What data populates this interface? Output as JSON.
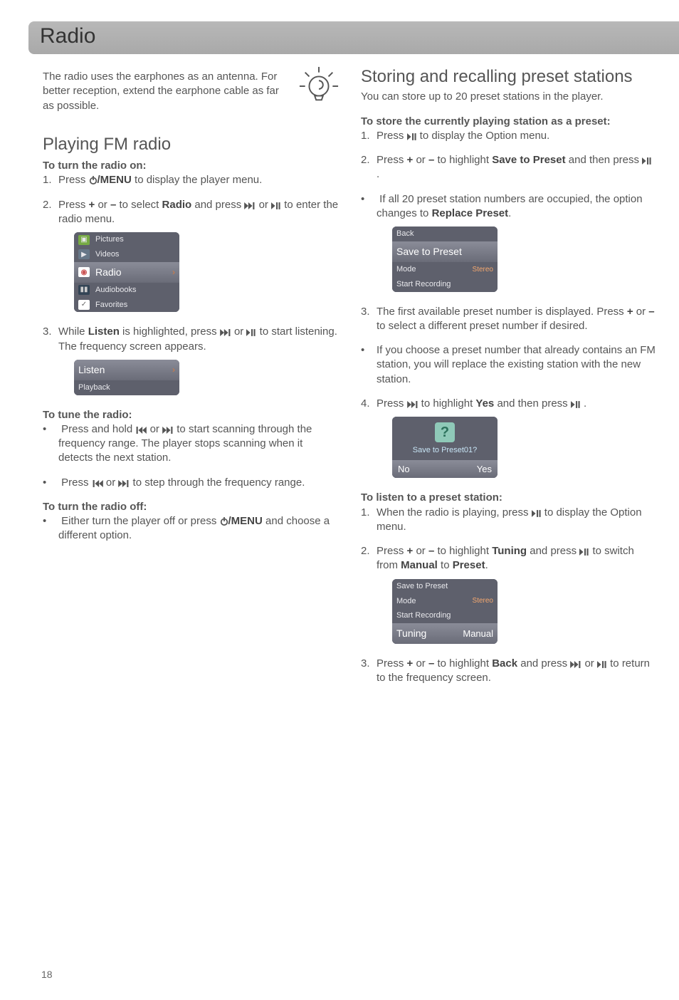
{
  "page_title": "Radio",
  "page_number": "18",
  "note": "The radio uses the earphones as an antenna. For better reception, extend the earphone cable as far as possible.",
  "left": {
    "h2": "Playing FM radio",
    "turn_on_head": "To turn the radio on:",
    "step1_a": "Press ",
    "step1_b": "/MENU",
    "step1_c": " to display the player menu.",
    "step2_a": "Press ",
    "step2_plus": "+",
    "step2_or": " or ",
    "step2_minus": "–",
    "step2_b": " to select ",
    "step2_radio": "Radio",
    "step2_c": " and press ",
    "step2_d": " or ",
    "step2_e": " to enter the radio menu.",
    "menu": {
      "pictures": "Pictures",
      "videos": "Videos",
      "radio": "Radio",
      "audiobooks": "Audiobooks",
      "favorites": "Favorites"
    },
    "step3_a": "While ",
    "step3_listen": "Listen",
    "step3_b": " is highlighted, press ",
    "step3_c": " or ",
    "step3_d": " to start listening. The frequency screen appears.",
    "listen_menu": {
      "listen": "Listen",
      "playback": "Playback"
    },
    "tune_head": "To tune the radio:",
    "tune1_a": "Press and hold ",
    "tune1_b": " or ",
    "tune1_c": " to start scanning through the frequency range. The player stops scanning when it detects the next station.",
    "tune2_a": "Press ",
    "tune2_b": " or ",
    "tune2_c": " to step through the frequency range.",
    "off_head": "To turn the radio off:",
    "off1_a": "Either turn the player off or press ",
    "off1_b": "/MENU",
    "off1_c": " and choose a different option."
  },
  "right": {
    "h2": "Storing and recalling preset stations",
    "intro": "You can store up to 20 preset stations in the player.",
    "store_head": "To store the currently playing station as a preset:",
    "s1_a": "Press ",
    "s1_b": " to display the Option menu.",
    "s2_a": "Press ",
    "s2_plus": "+",
    "s2_or": " or ",
    "s2_minus": "–",
    "s2_b": " to highlight ",
    "s2_save": "Save to Preset",
    "s2_c": " and then press ",
    "s2_d": " .",
    "s2_note_a": "If all 20 preset station numbers are occupied, the option changes to ",
    "s2_note_b": "Replace Preset",
    "s2_note_c": ".",
    "save_menu": {
      "back": "Back",
      "save": "Save to Preset",
      "mode": "Mode",
      "stereo": "Stereo",
      "start_rec": "Start Recording"
    },
    "s3_a": "The first available preset number is displayed. Press ",
    "s3_plus": "+",
    "s3_or": " or ",
    "s3_minus": "–",
    "s3_b": " to select a different preset number if desired.",
    "s3_note": "If you choose a preset number that already contains an FM station, you will replace the existing station with the new station.",
    "s4_a": "Press ",
    "s4_b": " to highlight ",
    "s4_yes": "Yes",
    "s4_c": " and then press ",
    "s4_d": " .",
    "prompt": {
      "q": "?",
      "label": "Save to Preset01?",
      "no": "No",
      "yes": "Yes"
    },
    "listen_head": "To listen to a preset station:",
    "l1_a": "When the radio is playing, press ",
    "l1_b": " to display the Option menu.",
    "l2_a": "Press ",
    "l2_plus": "+",
    "l2_or": " or ",
    "l2_minus": "–",
    "l2_b": " to highlight ",
    "l2_tuning": "Tuning",
    "l2_c": " and press ",
    "l2_d": " to switch from ",
    "l2_manual": "Manual",
    "l2_to": " to ",
    "l2_preset": "Preset",
    "l2_e": ".",
    "tuning_menu": {
      "save": "Save to Preset",
      "mode": "Mode",
      "stereo": "Stereo",
      "start_rec": "Start Recording",
      "tuning": "Tuning",
      "manual": "Manual"
    },
    "l3_a": "Press ",
    "l3_plus": "+",
    "l3_or": " or ",
    "l3_minus": "–",
    "l3_b": " to highlight ",
    "l3_back": "Back",
    "l3_c": " and press ",
    "l3_d": " or ",
    "l3_e": " to return to the frequency screen."
  }
}
